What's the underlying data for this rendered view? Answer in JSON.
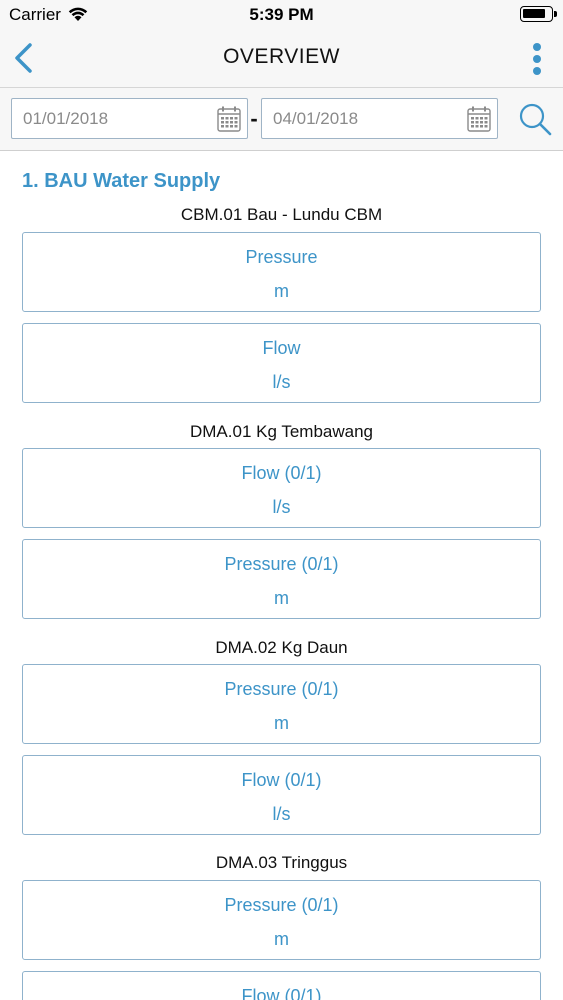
{
  "status_bar": {
    "carrier": "Carrier",
    "time": "5:39 PM"
  },
  "nav": {
    "title": "OVERVIEW"
  },
  "filter": {
    "date_from": "01/01/2018",
    "date_to": "04/01/2018",
    "separator": "-"
  },
  "section": {
    "title": "1. BAU Water Supply"
  },
  "stations": [
    {
      "name": "CBM.01 Bau - Lundu CBM",
      "cards": [
        {
          "label": "Pressure",
          "unit": "m"
        },
        {
          "label": "Flow",
          "unit": "l/s"
        }
      ]
    },
    {
      "name": "DMA.01 Kg Tembawang",
      "cards": [
        {
          "label": "Flow (0/1)",
          "unit": "l/s"
        },
        {
          "label": "Pressure (0/1)",
          "unit": "m"
        }
      ]
    },
    {
      "name": "DMA.02 Kg Daun",
      "cards": [
        {
          "label": "Pressure (0/1)",
          "unit": "m"
        },
        {
          "label": "Flow (0/1)",
          "unit": "l/s"
        }
      ]
    },
    {
      "name": "DMA.03 Tringgus",
      "cards": [
        {
          "label": "Pressure (0/1)",
          "unit": "m"
        },
        {
          "label": "Flow (0/1)",
          "unit": ""
        }
      ]
    }
  ],
  "colors": {
    "accent": "#3d94c8",
    "card_border": "#8fb2cc",
    "bar_bg": "#f7f7f7"
  },
  "icons": {
    "back": "chevron-left-icon",
    "more": "vertical-dots-icon",
    "calendar": "calendar-icon",
    "search": "search-icon",
    "wifi": "wifi-icon",
    "battery": "battery-icon"
  }
}
